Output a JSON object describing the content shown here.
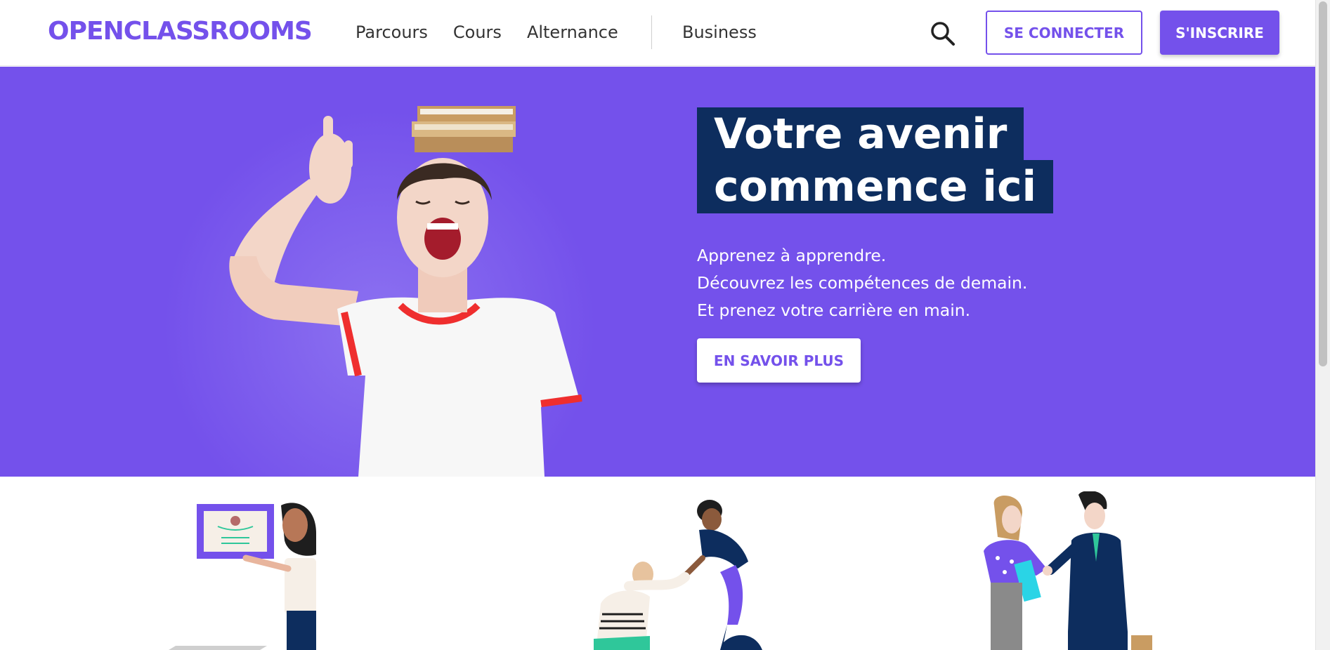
{
  "header": {
    "logo": "OPENCLASSROOMS",
    "nav": [
      "Parcours",
      "Cours",
      "Alternance"
    ],
    "business": "Business",
    "search_icon": "search-icon",
    "login_label": "SE CONNECTER",
    "signup_label": "S'INSCRIRE"
  },
  "hero": {
    "title_line1": "Votre avenir",
    "title_line2": "commence ici",
    "subtitle": [
      "Apprenez à apprendre.",
      "Découvrez les compétences de demain.",
      "Et prenez votre carrière en main."
    ],
    "cta_label": "EN SAVOIR PLUS",
    "image": "woman-with-books-on-head"
  },
  "illustrations": [
    "diploma-illustration",
    "helping-hand-illustration",
    "handshake-illustration"
  ],
  "colors": {
    "brand": "#7451eb",
    "title_bg": "#0d2d5e"
  }
}
